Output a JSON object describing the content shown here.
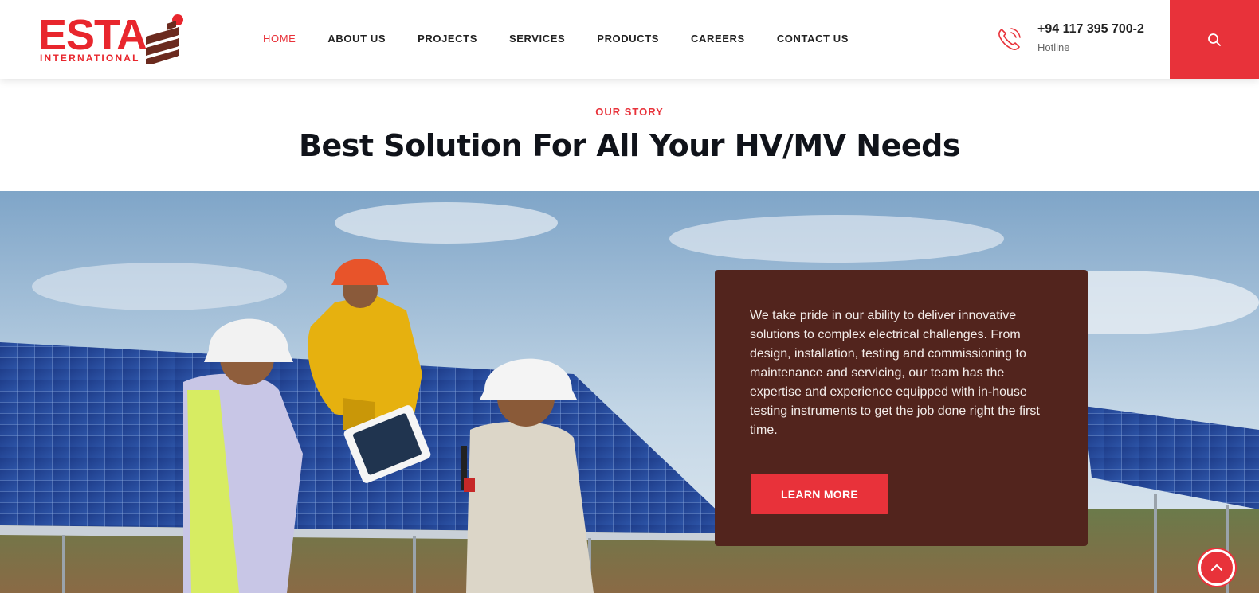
{
  "brand": {
    "logo_text": "ESTA",
    "logo_subtext": "INTERNATIONAL",
    "accent_color": "#e8323a",
    "card_color": "#52241d"
  },
  "nav": {
    "items": [
      {
        "label": "HOME",
        "active": true
      },
      {
        "label": "ABOUT US"
      },
      {
        "label": "PROJECTS"
      },
      {
        "label": "SERVICES"
      },
      {
        "label": "PRODUCTS"
      },
      {
        "label": "CAREERS"
      },
      {
        "label": "CONTACT US"
      }
    ]
  },
  "hotline": {
    "number": "+94 117 395 700-2",
    "label": "Hotline",
    "icon": "phone-icon"
  },
  "search": {
    "icon": "search-icon"
  },
  "section": {
    "eyebrow": "OUR STORY",
    "title": "Best Solution For All Your HV/MV Needs"
  },
  "story": {
    "text": "We take pride in our ability to deliver innovative solutions to complex electrical challenges. From design, installation, testing and commissioning to maintenance and servicing, our team has the expertise and experience equipped with in-house testing instruments to get the job done right the first time.",
    "button_label": "LEARN MORE"
  },
  "scroll_top": {
    "icon": "arrow-up-icon"
  }
}
